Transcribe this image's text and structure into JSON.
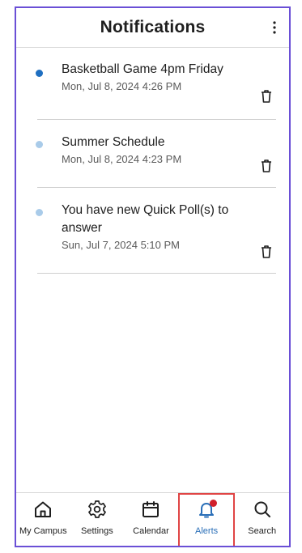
{
  "header": {
    "title": "Notifications",
    "menu_icon": "more-vertical-icon"
  },
  "notifications": [
    {
      "title": "Basketball Game 4pm Friday",
      "date": "Mon, Jul 8, 2024 4:26 PM",
      "unread": true,
      "dot_color": "#1f6fc1"
    },
    {
      "title": "Summer Schedule",
      "date": "Mon, Jul 8, 2024 4:23 PM",
      "unread": false,
      "dot_color": "#a9cbe9"
    },
    {
      "title": "You have new Quick Poll(s) to answer",
      "date": "Sun, Jul 7, 2024 5:10 PM",
      "unread": false,
      "dot_color": "#a9cbe9"
    }
  ],
  "tabs": [
    {
      "label": "My Campus",
      "icon": "home-icon"
    },
    {
      "label": "Settings",
      "icon": "gear-icon"
    },
    {
      "label": "Calendar",
      "icon": "calendar-icon"
    },
    {
      "label": "Alerts",
      "icon": "bell-icon",
      "active": true
    },
    {
      "label": "Search",
      "icon": "search-icon"
    }
  ],
  "colors": {
    "accent": "#2a6fb8",
    "frame": "#6a4fd6",
    "highlight": "#e04545",
    "badge": "#d11f2a"
  }
}
